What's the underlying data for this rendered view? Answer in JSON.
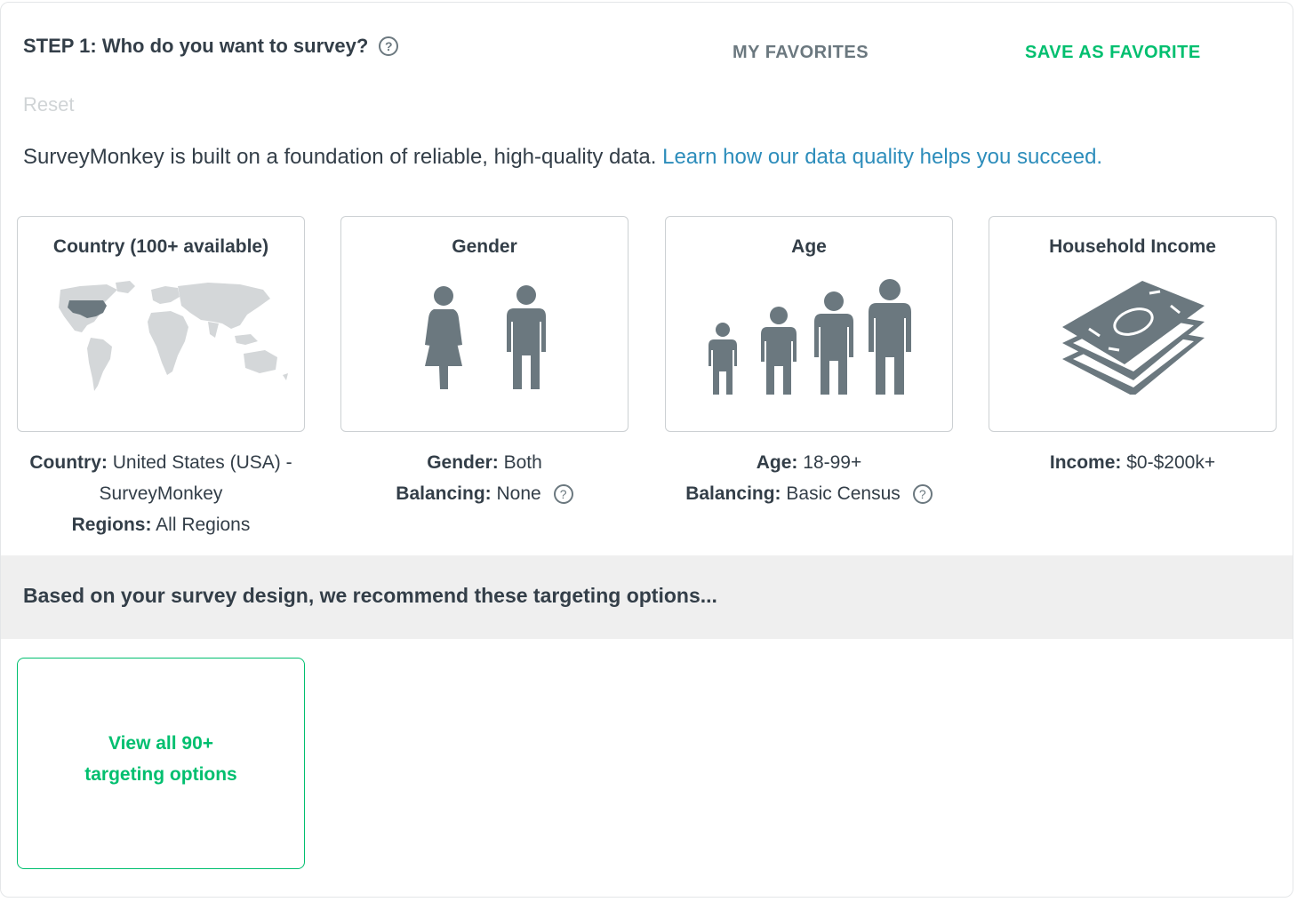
{
  "header": {
    "title": "STEP 1: Who do you want to survey?",
    "help_icon": "question-circle-icon",
    "my_favorites": "MY FAVORITES",
    "save_as_favorite": "SAVE AS FAVORITE",
    "reset": "Reset"
  },
  "intro": {
    "text": "SurveyMonkey is built on a foundation of reliable, high-quality data.",
    "link": "Learn how our data quality helps you succeed."
  },
  "cards": [
    {
      "title": "Country (100+ available)",
      "icon": "world-map-icon",
      "summary": [
        {
          "label": "Country:",
          "value": "United States (USA) -"
        },
        {
          "label": "",
          "value": "SurveyMonkey"
        },
        {
          "label": "Regions:",
          "value": "All Regions"
        }
      ]
    },
    {
      "title": "Gender",
      "icon": "gender-icon",
      "summary": [
        {
          "label": "Gender:",
          "value": "Both"
        },
        {
          "label": "Balancing:",
          "value": "None"
        }
      ]
    },
    {
      "title": "Age",
      "icon": "age-group-icon",
      "summary": [
        {
          "label": "Age:",
          "value": "18-99+"
        },
        {
          "label": "Balancing:",
          "value": "Basic Census"
        }
      ]
    },
    {
      "title": "Household Income",
      "icon": "money-stack-icon",
      "summary": [
        {
          "label": "Income:",
          "value": "$0-$200k+"
        }
      ]
    }
  ],
  "recommend": {
    "text": "Based on your survey design, we recommend these targeting options..."
  },
  "view_all": {
    "line1": "View all 90+",
    "line2": "targeting options"
  },
  "colors": {
    "accent_green": "#00bf6f",
    "link_blue": "#2d8dbb",
    "icon_gray": "#6b787f",
    "text_dark": "#333e48",
    "map_gray": "#d4d7d9",
    "map_highlight": "#6b787f"
  }
}
